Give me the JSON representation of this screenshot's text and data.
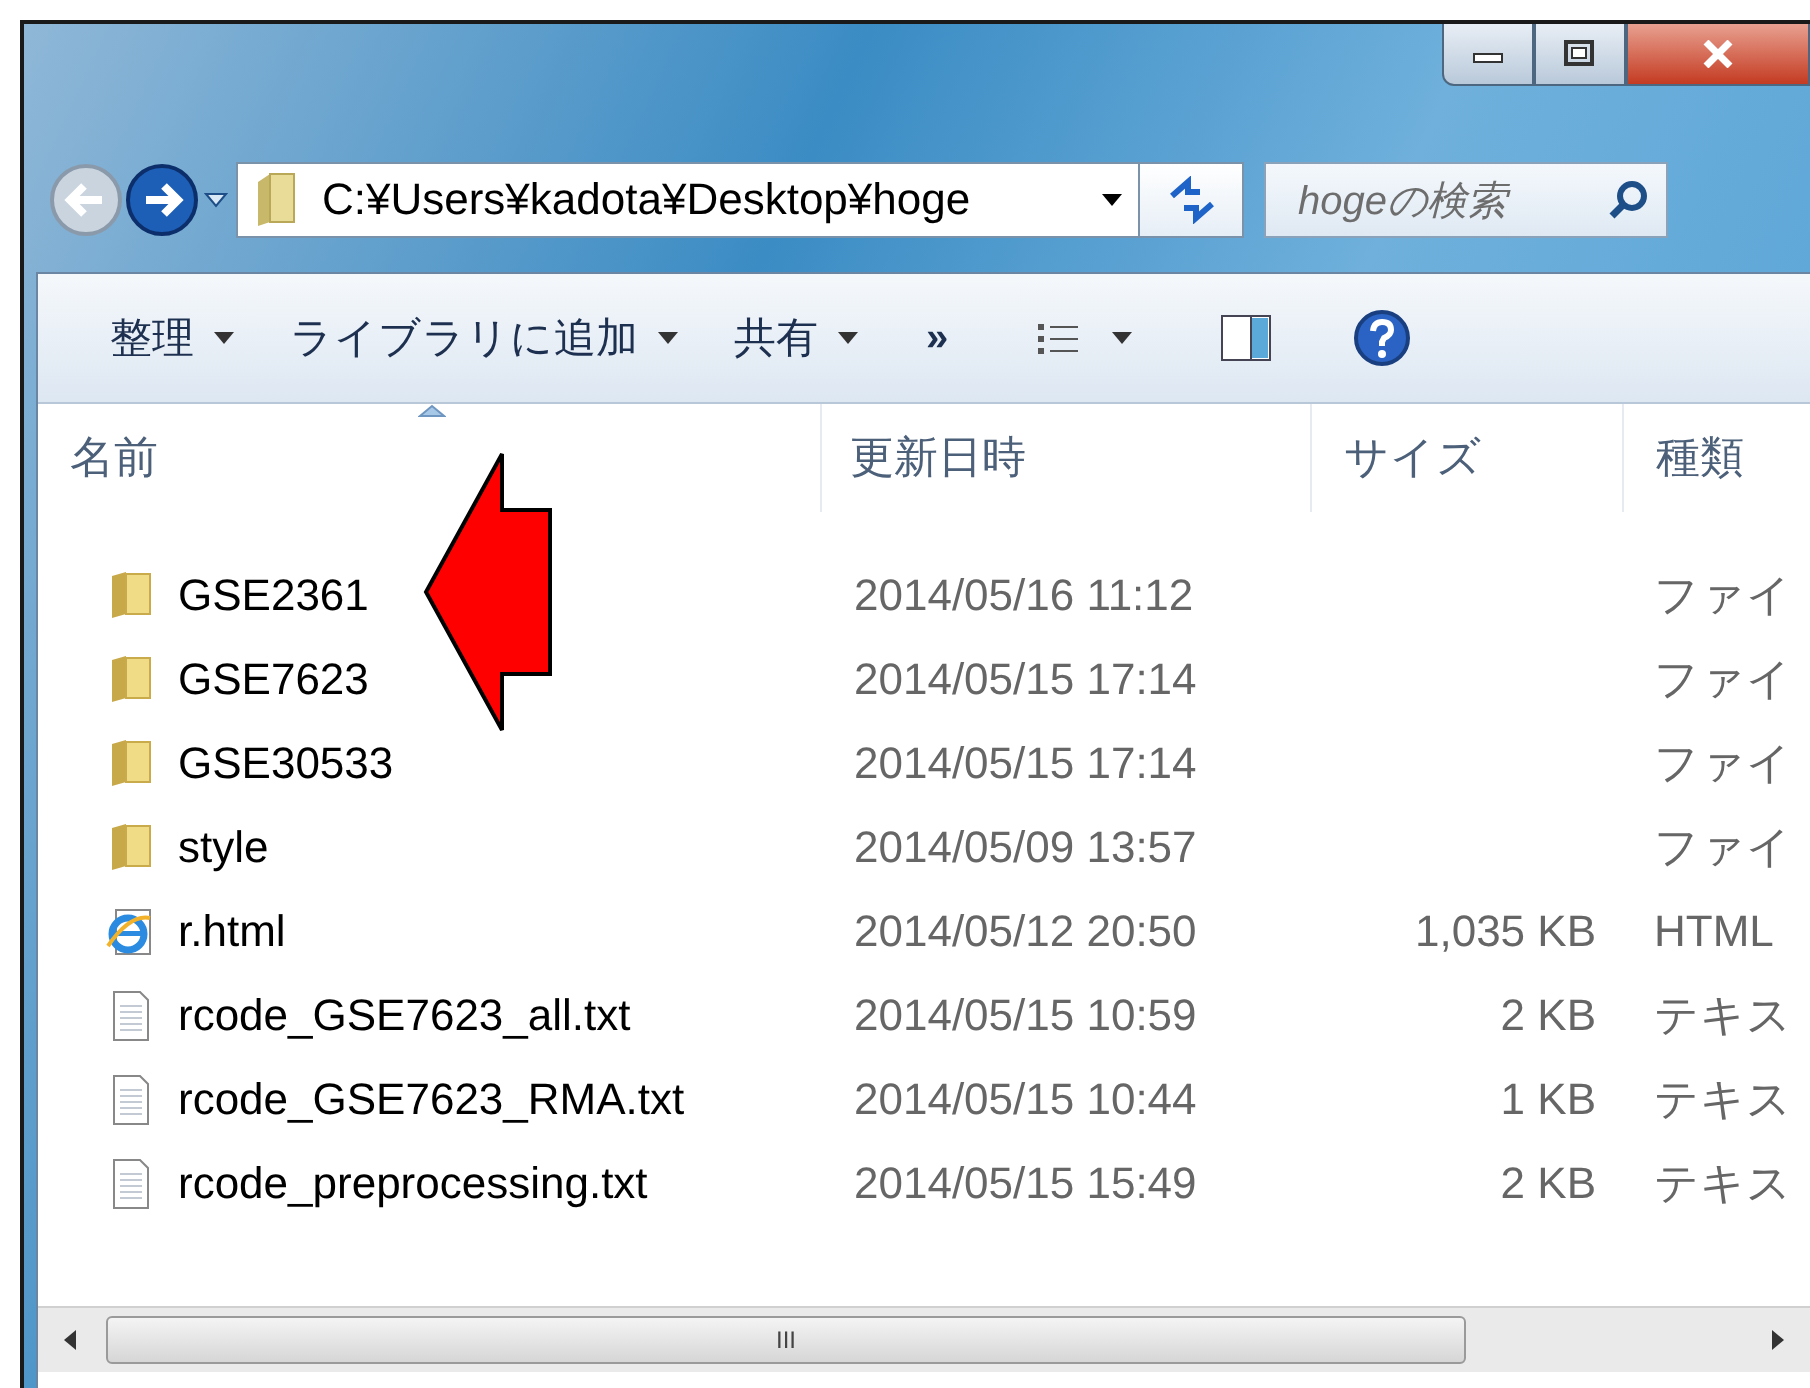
{
  "address_bar": {
    "path": "C:¥Users¥kadota¥Desktop¥hoge"
  },
  "search": {
    "placeholder": "hogeの検索"
  },
  "toolbar": [
    {
      "label": "整理",
      "kind": "menu"
    },
    {
      "label": "ライブラリに追加",
      "kind": "menu"
    },
    {
      "label": "共有",
      "kind": "menu"
    },
    {
      "label": "»",
      "kind": "more"
    },
    {
      "kind": "views"
    },
    {
      "kind": "pane"
    },
    {
      "kind": "help"
    }
  ],
  "table": {
    "columns": [
      "名前",
      "更新日時",
      "サイズ",
      "種類"
    ],
    "rows": [
      {
        "kind": "folder",
        "name": "GSE2361",
        "modified": "2014/05/16 11:12",
        "type": "ファイ"
      },
      {
        "kind": "folder",
        "name": "GSE7623",
        "modified": "2014/05/15 17:14",
        "type": "ファイ"
      },
      {
        "kind": "folder",
        "name": "GSE30533",
        "modified": "2014/05/15 17:14",
        "type": "ファイ"
      },
      {
        "kind": "folder",
        "name": "style",
        "modified": "2014/05/09 13:57",
        "type": "ファイ"
      },
      {
        "kind": "html",
        "name": "r.html",
        "modified": "2014/05/12 20:50",
        "size": "1,035 KB",
        "type": "HTML"
      },
      {
        "kind": "text",
        "name": "rcode_GSE7623_all.txt",
        "modified": "2014/05/15 10:59",
        "size": "2 KB",
        "type": "テキス"
      },
      {
        "kind": "text",
        "name": "rcode_GSE7623_RMA.txt",
        "modified": "2014/05/15 10:44",
        "size": "1 KB",
        "type": "テキス"
      },
      {
        "kind": "text",
        "name": "rcode_preprocessing.txt",
        "modified": "2014/05/15 15:49",
        "size": "2 KB",
        "type": "テキス"
      }
    ]
  },
  "scrollbar": {
    "grip": "III"
  },
  "annotations": [
    {
      "kind": "arrow"
    }
  ]
}
